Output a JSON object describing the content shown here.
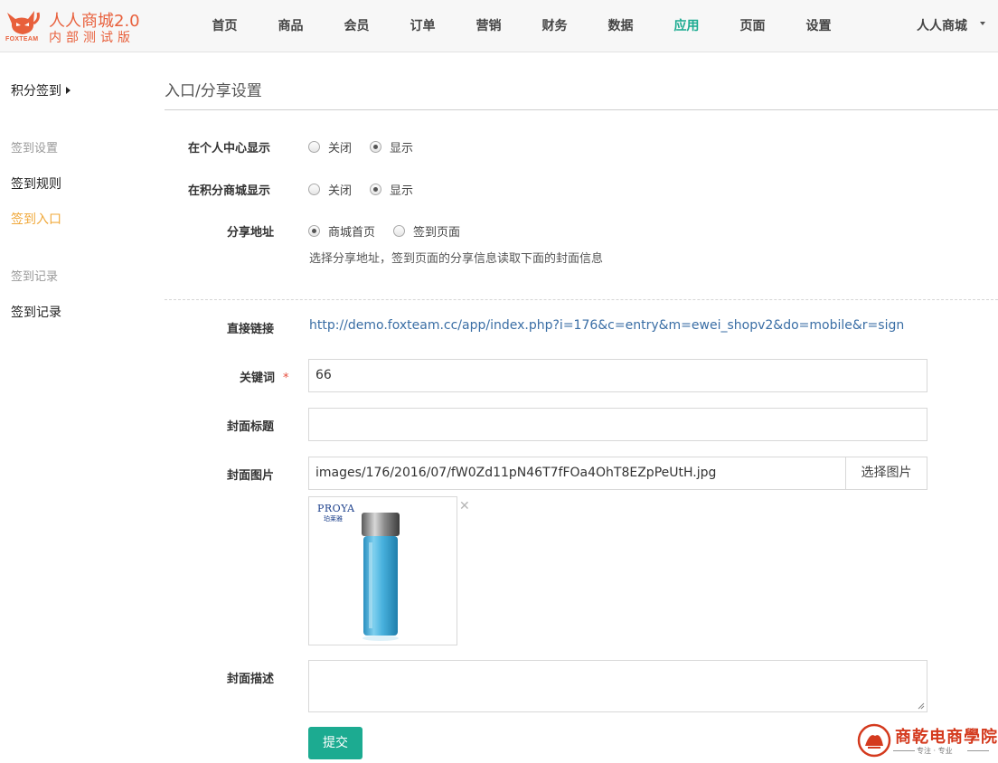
{
  "header": {
    "logo_en": "FOXTEAM",
    "logo_title": "人人商城2.0",
    "logo_sub": "内部测试版",
    "nav": [
      {
        "label": "首页"
      },
      {
        "label": "商品"
      },
      {
        "label": "会员"
      },
      {
        "label": "订单"
      },
      {
        "label": "营销"
      },
      {
        "label": "财务"
      },
      {
        "label": "数据"
      },
      {
        "label": "应用",
        "active": true
      },
      {
        "label": "页面"
      },
      {
        "label": "设置"
      }
    ],
    "store_name": "人人商城"
  },
  "sidebar": {
    "head": "积分签到",
    "groups": [
      {
        "title": "签到设置",
        "items": [
          {
            "label": "签到规则"
          },
          {
            "label": "签到入口",
            "active": true
          }
        ]
      },
      {
        "title": "签到记录",
        "items": [
          {
            "label": "签到记录"
          }
        ]
      }
    ]
  },
  "main": {
    "title": "入口/分享设置",
    "fields": {
      "member_center": {
        "label": "在个人中心显示",
        "options": [
          "关闭",
          "显示"
        ],
        "selected": "显示"
      },
      "credit_shop": {
        "label": "在积分商城显示",
        "options": [
          "关闭",
          "显示"
        ],
        "selected": "显示"
      },
      "share_url": {
        "label": "分享地址",
        "options": [
          "商城首页",
          "签到页面"
        ],
        "selected": "商城首页",
        "help": "选择分享地址，签到页面的分享信息读取下面的封面信息"
      },
      "direct_link": {
        "label": "直接链接",
        "value": "http://demo.foxteam.cc/app/index.php?i=176&c=entry&m=ewei_shopv2&do=mobile&r=sign"
      },
      "keyword": {
        "label": "关键词",
        "required_mark": "*",
        "value": "66"
      },
      "cover_title": {
        "label": "封面标题",
        "value": ""
      },
      "cover_image": {
        "label": "封面图片",
        "value": "images/176/2016/07/fW0Zd11pN46T7fFOa4OhT8EZpPeUtH.jpg",
        "button": "选择图片",
        "remove_glyph": "✕",
        "thumb_brand": "PROYA",
        "thumb_brand_cn": "珀莱雅"
      },
      "cover_desc": {
        "label": "封面描述",
        "value": ""
      }
    },
    "submit": "提交"
  },
  "watermark": {
    "title": "商乾电商學院",
    "sub": "专注 · 专业"
  },
  "colors": {
    "accent": "#1cab91",
    "brand": "#e8603c",
    "sidebar_active": "#f0a83a",
    "link": "#3a6ea5"
  }
}
